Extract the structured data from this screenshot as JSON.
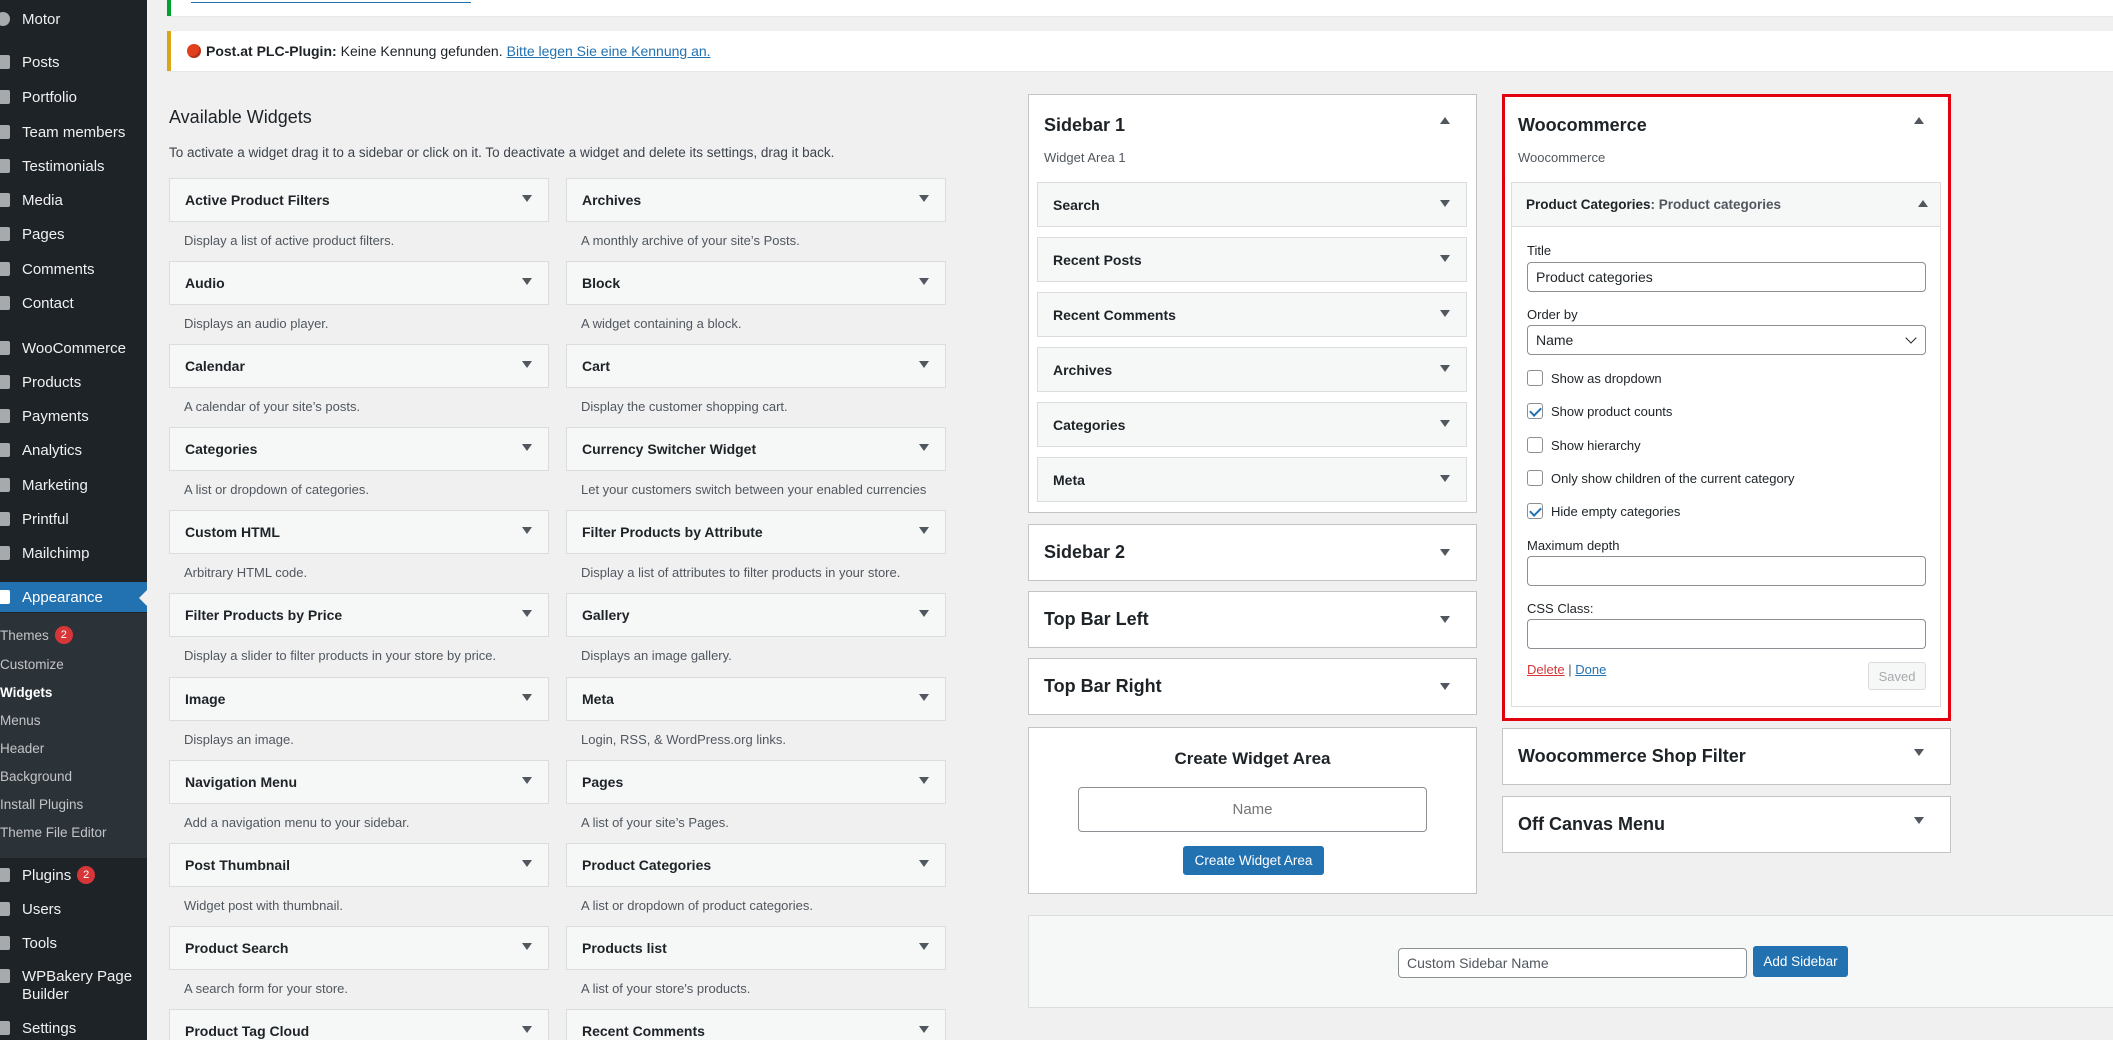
{
  "admin_menu": {
    "items": [
      {
        "label": "Motor",
        "icon": "motor-icon"
      },
      {
        "label": "Posts",
        "icon": "pin-icon"
      },
      {
        "label": "Portfolio",
        "icon": "grid-icon"
      },
      {
        "label": "Team members",
        "icon": "people-icon"
      },
      {
        "label": "Testimonials",
        "icon": "quote-icon"
      },
      {
        "label": "Media",
        "icon": "media-icon"
      },
      {
        "label": "Pages",
        "icon": "pages-icon"
      },
      {
        "label": "Comments",
        "icon": "comments-icon"
      },
      {
        "label": "Contact",
        "icon": "mail-icon"
      },
      {
        "label": "WooCommerce",
        "icon": "woo-icon"
      },
      {
        "label": "Products",
        "icon": "products-icon"
      },
      {
        "label": "Payments",
        "icon": "payments-icon"
      },
      {
        "label": "Analytics",
        "icon": "analytics-icon"
      },
      {
        "label": "Marketing",
        "icon": "megaphone-icon"
      },
      {
        "label": "Printful",
        "icon": "printful-icon"
      },
      {
        "label": "Mailchimp",
        "icon": "mailchimp-icon"
      },
      {
        "label": "Appearance",
        "icon": "brush-icon"
      },
      {
        "label": "Plugins",
        "icon": "plug-icon",
        "badge": "2"
      },
      {
        "label": "Users",
        "icon": "users-icon"
      },
      {
        "label": "Tools",
        "icon": "wrench-icon"
      },
      {
        "label": "WPBakery Page",
        "label2": "Builder",
        "icon": "wpbakery-icon"
      },
      {
        "label": "Settings",
        "icon": "settings-icon"
      }
    ],
    "submenu": [
      {
        "label": "Themes",
        "badge": "2"
      },
      {
        "label": "Customize"
      },
      {
        "label": "Widgets"
      },
      {
        "label": "Menus"
      },
      {
        "label": "Header"
      },
      {
        "label": "Background"
      },
      {
        "label": "Install Plugins"
      },
      {
        "label": "Theme File Editor"
      }
    ]
  },
  "notices": {
    "plc_bold": "Post.at PLC-Plugin:",
    "plc_text": "Keine Kennung gefunden.",
    "plc_link": "Bitte legen Sie eine Kennung an."
  },
  "available": {
    "title": "Available Widgets",
    "description": "To activate a widget drag it to a sidebar or click on it. To deactivate a widget and delete its settings, drag it back.",
    "widgets": [
      {
        "name": "Active Product Filters",
        "desc": "Display a list of active product filters."
      },
      {
        "name": "Archives",
        "desc": "A monthly archive of your site’s Posts."
      },
      {
        "name": "Audio",
        "desc": "Displays an audio player."
      },
      {
        "name": "Block",
        "desc": "A widget containing a block."
      },
      {
        "name": "Calendar",
        "desc": "A calendar of your site’s posts."
      },
      {
        "name": "Cart",
        "desc": "Display the customer shopping cart."
      },
      {
        "name": "Categories",
        "desc": "A list or dropdown of categories."
      },
      {
        "name": "Currency Switcher Widget",
        "desc": "Let your customers switch between your enabled currencies"
      },
      {
        "name": "Custom HTML",
        "desc": "Arbitrary HTML code."
      },
      {
        "name": "Filter Products by Attribute",
        "desc": "Display a list of attributes to filter products in your store."
      },
      {
        "name": "Filter Products by Price",
        "desc": "Display a slider to filter products in your store by price."
      },
      {
        "name": "Gallery",
        "desc": "Displays an image gallery."
      },
      {
        "name": "Image",
        "desc": "Displays an image."
      },
      {
        "name": "Meta",
        "desc": "Login, RSS, & WordPress.org links."
      },
      {
        "name": "Navigation Menu",
        "desc": "Add a navigation menu to your sidebar."
      },
      {
        "name": "Pages",
        "desc": "A list of your site’s Pages."
      },
      {
        "name": "Post Thumbnail",
        "desc": "Widget post with thumbnail."
      },
      {
        "name": "Product Categories",
        "desc": "A list or dropdown of product categories."
      },
      {
        "name": "Product Search",
        "desc": "A search form for your store."
      },
      {
        "name": "Products list",
        "desc": "A list of your store's products."
      },
      {
        "name": "Product Tag Cloud",
        "desc": ""
      },
      {
        "name": "Recent Comments",
        "desc": ""
      }
    ]
  },
  "sidebar1": {
    "title": "Sidebar 1",
    "subtitle": "Widget Area 1",
    "widgets": [
      "Search",
      "Recent Posts",
      "Recent Comments",
      "Archives",
      "Categories",
      "Meta"
    ]
  },
  "collapsed_areas": [
    "Sidebar 2",
    "Top Bar Left",
    "Top Bar Right"
  ],
  "create_area": {
    "title": "Create Widget Area",
    "input_placeholder": "Name",
    "button": "Create Widget Area"
  },
  "woocommerce": {
    "title": "Woocommerce",
    "subtitle": "Woocommerce",
    "widget_title_bold": "Product Categories",
    "widget_title_rest": ": Product categories",
    "fields": {
      "title_label": "Title",
      "title_value": "Product categories",
      "orderby_label": "Order by",
      "orderby_value": "Name",
      "checkboxes": [
        {
          "label": "Show as dropdown",
          "checked": false
        },
        {
          "label": "Show product counts",
          "checked": true
        },
        {
          "label": "Show hierarchy",
          "checked": false
        },
        {
          "label": "Only show children of the current category",
          "checked": false
        },
        {
          "label": "Hide empty categories",
          "checked": true
        }
      ],
      "depth_label": "Maximum depth",
      "depth_value": "",
      "css_label": "CSS Class:",
      "css_value": ""
    },
    "delete": "Delete",
    "separator": "|",
    "done": "Done",
    "saved": "Saved"
  },
  "right_collapsed": [
    "Woocommerce Shop Filter",
    "Off Canvas Menu"
  ],
  "custom_sidebar": {
    "placeholder": "Custom Sidebar Name",
    "button": "Add Sidebar"
  },
  "colors": {
    "admin_bg": "#1d2327",
    "accent": "#2271b1",
    "highlight_border": "#e3000f",
    "badge": "#d63638"
  }
}
